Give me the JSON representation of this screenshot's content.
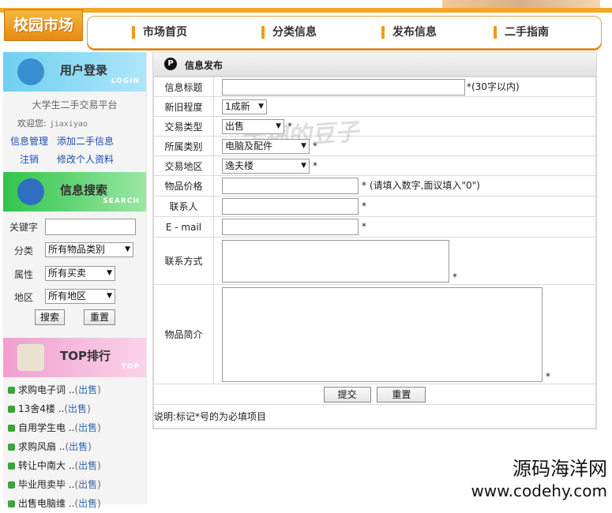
{
  "header": {
    "logo": "校园市场",
    "nav": [
      "市场首页",
      "分类信息",
      "发布信息",
      "二手指南"
    ]
  },
  "sidebar": {
    "login": {
      "title": "用户登录",
      "subtitle": "LOGIN",
      "platform": "大学生二手交易平台",
      "welcome": "欢迎您:",
      "username": "jiaxiyao",
      "links": [
        "信息管理",
        "添加二手信息",
        "注销",
        "修改个人资料"
      ]
    },
    "search": {
      "title": "信息搜索",
      "subtitle": "SEARCH",
      "keyword_label": "关键字",
      "keyword_value": "",
      "category_label": "分类",
      "category_value": "所有物品类别",
      "attr_label": "属性",
      "attr_value": "所有买卖",
      "region_label": "地区",
      "region_value": "所有地区",
      "search_btn": "搜索",
      "reset_btn": "重置"
    },
    "top": {
      "title": "TOP排行",
      "subtitle": "TOP",
      "items": [
        {
          "text": "求购电子词 ..",
          "tag": "出售"
        },
        {
          "text": "13舍4楼 ..",
          "tag": "出售"
        },
        {
          "text": "自用学生电 ..",
          "tag": "出售"
        },
        {
          "text": "求购风扇 ..",
          "tag": "出售"
        },
        {
          "text": "转让中南大 ..",
          "tag": "出售"
        },
        {
          "text": "毕业甩卖毕 ..",
          "tag": "出售"
        },
        {
          "text": "出售电脑维 ..",
          "tag": "出售"
        }
      ]
    }
  },
  "main": {
    "title": "信息发布",
    "watermark": "金银的豆子",
    "fields": {
      "title_label": "信息标题",
      "title_hint": "*(30字以内)",
      "condition_label": "新旧程度",
      "condition_value": "1成新",
      "type_label": "交易类型",
      "type_value": "出售",
      "category_label": "所属类别",
      "category_value": "电脑及配件",
      "region_label": "交易地区",
      "region_value": "逸夫楼",
      "price_label": "物品价格",
      "price_hint": "(请填入数字,面议填入\"0\")",
      "contact_label": "联系人",
      "email_label": "E - mail",
      "contact_method_label": "联系方式",
      "intro_label": "物品简介",
      "star": "*"
    },
    "submit_btn": "提交",
    "reset_btn": "重置",
    "note": "说明:标记*号的为必填项目"
  },
  "footer_watermark": {
    "line1": "源码海洋网",
    "line2": "www.codehy.com"
  }
}
